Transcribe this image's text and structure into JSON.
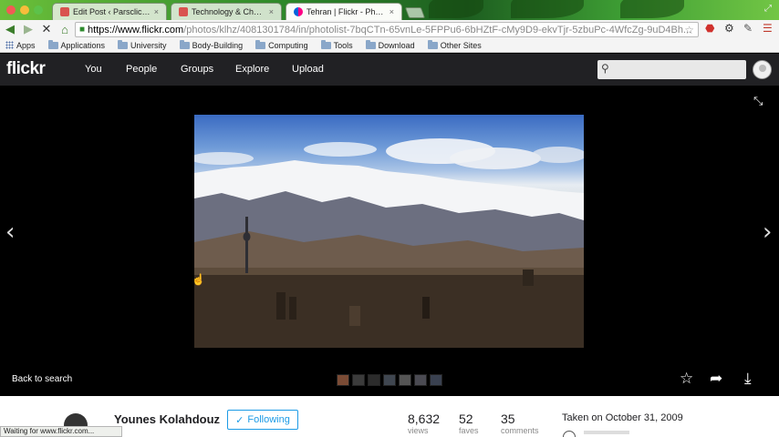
{
  "browser": {
    "tabs": [
      {
        "label": "Edit Post ‹ Parsclick — W",
        "active": false
      },
      {
        "label": "Technology & Change | F",
        "active": false
      },
      {
        "label": "Tehran | Flickr - Photo Sh",
        "active": true
      }
    ],
    "url_host": "https://www.flickr.com",
    "url_path": "/photos/klhz/4081301784/in/photolist-7bqCTn-65vnLe-5FPPu6-6bHZtF-cMy9D9-ekvTjr-5zbuPc-4WfcZg-9uD4Bh...",
    "bookmarks": [
      "Apps",
      "Applications",
      "University",
      "Body-Building",
      "Computing",
      "Tools",
      "Download",
      "Other Sites"
    ],
    "status": "Waiting for www.flickr.com..."
  },
  "flickr": {
    "logo": "flickr",
    "nav": [
      "You",
      "People",
      "Groups",
      "Explore",
      "Upload"
    ],
    "back_label": "Back to search",
    "owner": "Younes Kolahdouz",
    "follow_label": "Following",
    "stats": [
      {
        "value": "8,632",
        "label": "views"
      },
      {
        "value": "52",
        "label": "faves"
      },
      {
        "value": "35",
        "label": "comments"
      }
    ],
    "taken": "Taken on October 31, 2009"
  },
  "colors": {
    "header_bg": "#212124",
    "follow_blue": "#1c9be6",
    "chrome_green": "#3e9e34"
  },
  "icons": [
    "search-icon",
    "expand-icon",
    "left-arrow-icon",
    "right-arrow-icon",
    "favorite-star-icon",
    "share-icon",
    "download-icon"
  ]
}
